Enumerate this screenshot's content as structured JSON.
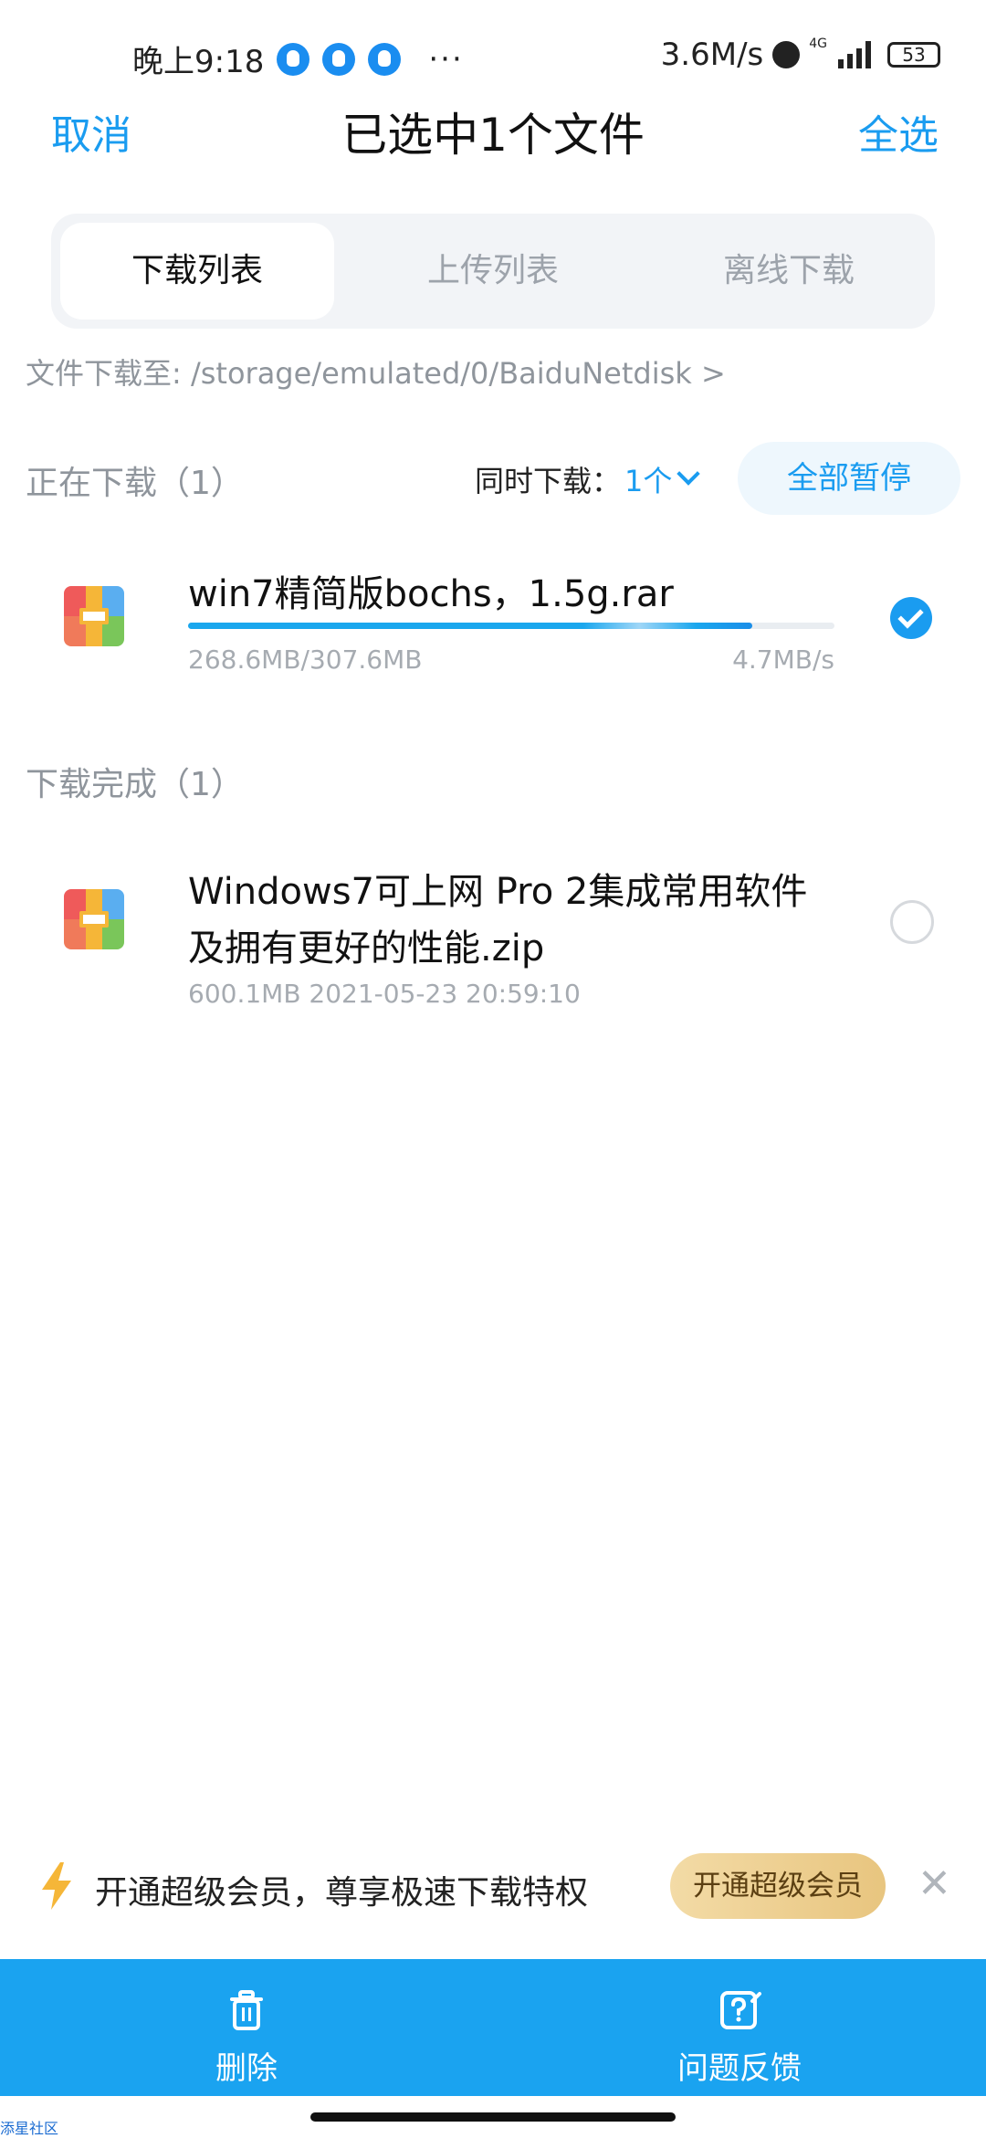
{
  "status_bar": {
    "time": "晚上9:18",
    "network_speed": "3.6M/s",
    "network_type": "4G",
    "battery": "53"
  },
  "header": {
    "cancel_label": "取消",
    "title": "已选中1个文件",
    "select_all_label": "全选"
  },
  "tabs": [
    {
      "label": "下载列表",
      "active": true
    },
    {
      "label": "上传列表",
      "active": false
    },
    {
      "label": "离线下载",
      "active": false
    }
  ],
  "download_path": "文件下载至: /storage/emulated/0/BaiduNetdisk >",
  "downloading": {
    "section_title": "正在下载（1）",
    "concurrent_label": "同时下载：",
    "concurrent_value": "1个",
    "pause_all_label": "全部暂停",
    "items": [
      {
        "name": "win7精简版bochs，1.5g.rar",
        "progress_text": "268.6MB/307.6MB",
        "speed": "4.7MB/s",
        "progress_fraction": 0.873,
        "selected": true
      }
    ]
  },
  "completed": {
    "section_title": "下载完成（1）",
    "items": [
      {
        "name_line1": "Windows7可上网 Pro 2集成常用软件",
        "name_line2": "及拥有更好的性能.zip",
        "meta": "600.1MB 2021-05-23 20:59:10",
        "selected": false
      }
    ]
  },
  "promo": {
    "text": "开通超级会员，尊享极速下载特权",
    "button_label": "开通超级会员",
    "close_icon": "close-icon"
  },
  "bottom_bar": {
    "delete_label": "删除",
    "feedback_label": "问题反馈"
  },
  "colors": {
    "accent": "#1a9cf0",
    "bottom_bar": "#1aa3f0",
    "promo_gold": "#e8c57f"
  },
  "corner_watermark": "添星社区"
}
